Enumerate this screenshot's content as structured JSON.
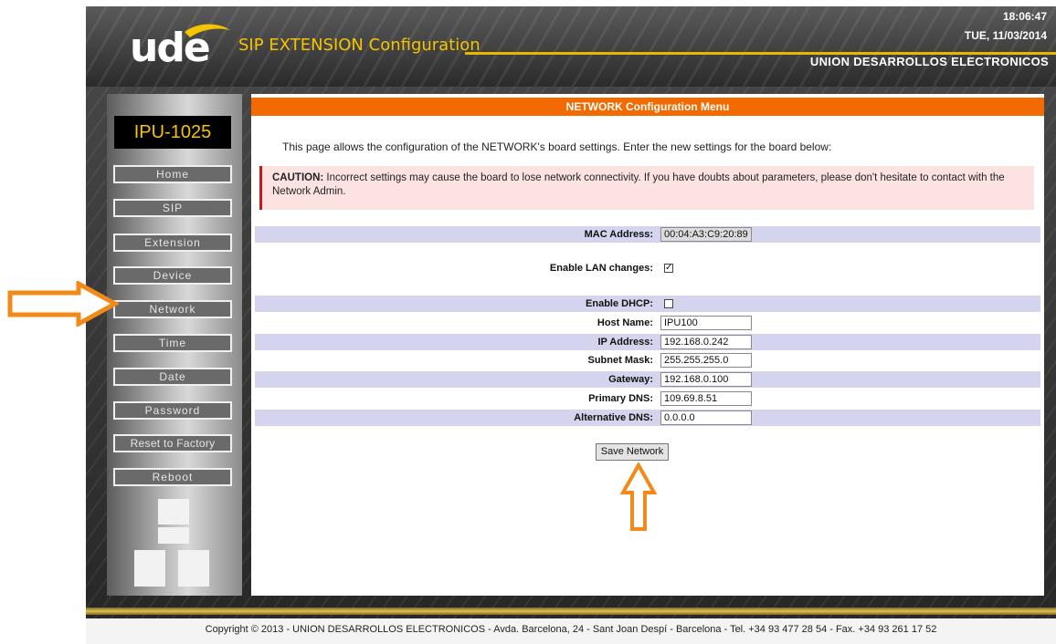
{
  "header": {
    "logo_text": "ude",
    "app_title": "SIP EXTENSION Configuration",
    "time": "18:06:47",
    "date": "TUE, 11/03/2014",
    "company": "UNION DESARROLLOS ELECTRONICOS"
  },
  "sidebar": {
    "device_name": "IPU-1025",
    "items": [
      {
        "label": "Home"
      },
      {
        "label": "SIP"
      },
      {
        "label": "Extension"
      },
      {
        "label": "Device"
      },
      {
        "label": "Network"
      },
      {
        "label": "Time"
      },
      {
        "label": "Date"
      },
      {
        "label": "Password"
      },
      {
        "label": "Reset to Factory"
      },
      {
        "label": "Reboot"
      }
    ]
  },
  "main": {
    "menu_title": "NETWORK Configuration Menu",
    "intro": "This page allows the configuration of the NETWORK's board settings. Enter the new settings for the board below:",
    "caution_label": "CAUTION:",
    "caution_text": " Incorrect settings may cause the board to lose network connectivity. If you have doubts about parameters, please don't hesitate to contact with the Network Admin.",
    "fields": {
      "mac": {
        "label": "MAC Address:",
        "value": "00:04:A3:C9:20:89"
      },
      "lan": {
        "label": "Enable LAN changes:",
        "checked": true,
        "mark": "✓"
      },
      "dhcp": {
        "label": "Enable DHCP:",
        "checked": false
      },
      "host": {
        "label": "Host Name:",
        "value": "IPU100"
      },
      "ip": {
        "label": "IP Address:",
        "value": "192.168.0.242"
      },
      "mask": {
        "label": "Subnet Mask:",
        "value": "255.255.255.0"
      },
      "gateway": {
        "label": "Gateway:",
        "value": "192.168.0.100"
      },
      "dns1": {
        "label": "Primary DNS:",
        "value": "109.69.8.51"
      },
      "dns2": {
        "label": "Alternative DNS:",
        "value": "0.0.0.0"
      }
    },
    "save_label": "Save Network"
  },
  "footer": {
    "copyright": "Copyright © 2013 - UNION DESARROLLOS ELECTRONICOS  -  Avda. Barcelona, 24 - Sant Joan Despí  -  Barcelona  -  Tel. +34 93 477 28 54  -  Fax. +34 93 261 17 52"
  },
  "colors": {
    "accent_orange": "#f26a00",
    "title_yellow": "#f5c400",
    "row_shade": "#d4d4ee",
    "caution_bg": "#fde2e2"
  },
  "icons": [
    "ude-logo",
    "arrow-right-icon",
    "arrow-up-icon"
  ]
}
